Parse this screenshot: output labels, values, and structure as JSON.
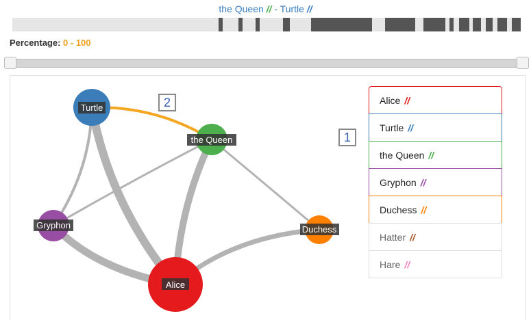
{
  "header": {
    "title_a": "the Queen",
    "sep1": "//",
    "dash": "-",
    "title_b": "Turtle",
    "sep2": "//",
    "color_a": "#4cae4c",
    "color_b": "#3a7dc0"
  },
  "filter": {
    "label": "Percentage:",
    "range": "0 - 100",
    "min": 0,
    "max": 100
  },
  "callouts": [
    "1",
    "2"
  ],
  "graph": {
    "nodes": [
      {
        "id": "Turtle",
        "label": "Turtle",
        "color": "#3a7db8"
      },
      {
        "id": "Queen",
        "label": "the Queen",
        "color": "#4cae4c"
      },
      {
        "id": "Gryphon",
        "label": "Gryphon",
        "color": "#984ea3"
      },
      {
        "id": "Duchess",
        "label": "Duchess",
        "color": "#ff7f00"
      },
      {
        "id": "Alice",
        "label": "Alice",
        "color": "#e41a1c"
      }
    ],
    "highlight_color": "#f5a623",
    "edge_color": "#b3b3b3"
  },
  "legend": {
    "items": [
      {
        "label": "Alice",
        "mark": "//",
        "color": "#e41a1c",
        "active": true
      },
      {
        "label": "Turtle",
        "mark": "//",
        "color": "#3a7db8",
        "active": true
      },
      {
        "label": "the Queen",
        "mark": "//",
        "color": "#4cae4c",
        "active": true
      },
      {
        "label": "Gryphon",
        "mark": "//",
        "color": "#984ea3",
        "active": true
      },
      {
        "label": "Duchess",
        "mark": "//",
        "color": "#ff7f00",
        "active": true
      },
      {
        "label": "Hatter",
        "mark": "//",
        "color": "#a65628",
        "active": false
      },
      {
        "label": "Hare",
        "mark": "//",
        "color": "#f781bf",
        "active": false
      }
    ]
  }
}
